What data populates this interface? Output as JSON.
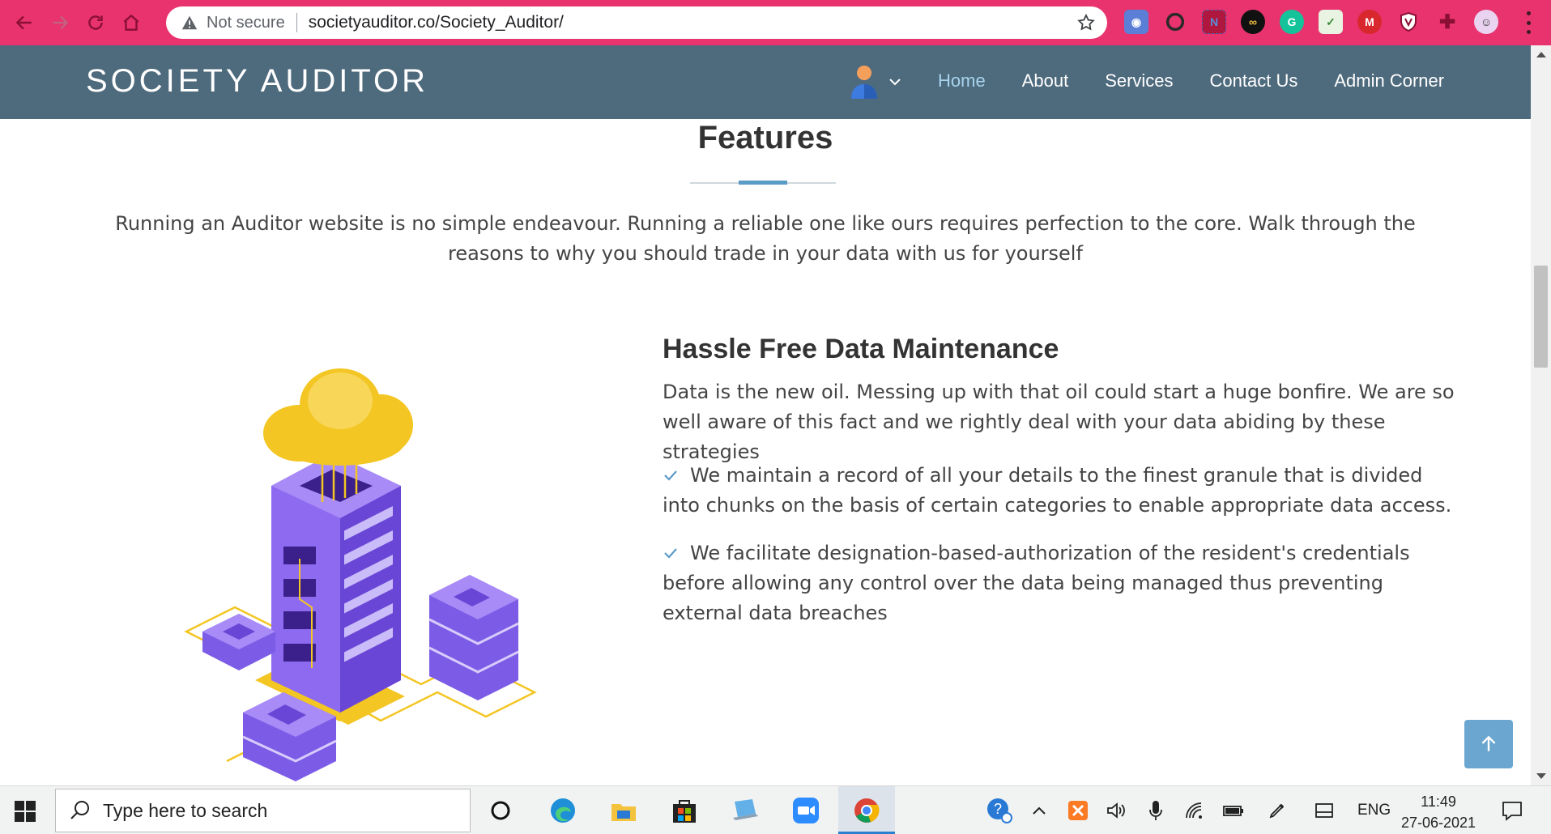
{
  "browser": {
    "security_label": "Not secure",
    "url": "societyauditor.co/Society_Auditor/",
    "extensions": [
      "camera-ext-icon",
      "opera-ext-icon",
      "notion-ext-icon",
      "infinity-ext-icon",
      "grammarly-ext-icon",
      "checklist-ext-icon",
      "mega-ext-icon",
      "shield-ext-icon",
      "puzzle-ext-icon",
      "profile-avatar-icon"
    ]
  },
  "site": {
    "brand": "SOCIETY AUDITOR",
    "nav": [
      {
        "label": "Home",
        "active": true
      },
      {
        "label": "About",
        "active": false
      },
      {
        "label": "Services",
        "active": false
      },
      {
        "label": "Contact Us",
        "active": false
      },
      {
        "label": "Admin Corner",
        "active": false
      }
    ]
  },
  "features": {
    "title": "Features",
    "intro": "Running an Auditor website is no simple endeavour. Running a reliable one like ours requires perfection to the core. Walk through the reasons to why you should trade in your data with us for yourself",
    "item": {
      "title": "Hassle Free Data Maintenance",
      "description": "Data is the new oil. Messing up with that oil could start a huge bonfire. We are so well aware of this fact and we rightly deal with your data abiding by these strategies",
      "bullets": [
        "We maintain a record of all your details to the finest granule that is divided into chunks on the basis of certain categories to enable appropriate data access.",
        "We facilitate designation-based-authorization of the resident's credentials before allowing any control over the data being managed thus preventing external data breaches"
      ]
    }
  },
  "taskbar": {
    "search_placeholder": "Type here to search",
    "language": "ENG",
    "time": "11:49",
    "date": "27-06-2021"
  },
  "colors": {
    "chrome": "#e8336f",
    "header": "#4e6a7d",
    "nav_active": "#a8d4ee",
    "accent": "#5b9bc8"
  }
}
